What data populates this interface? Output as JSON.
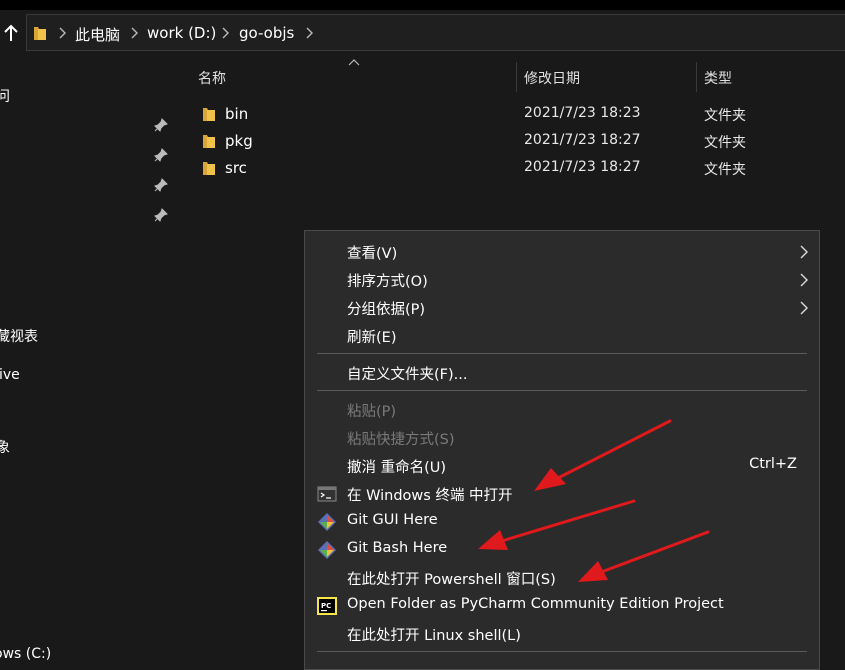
{
  "address_bar": {
    "breadcrumbs": [
      "此电脑",
      "work (D:)",
      "go-objs"
    ]
  },
  "sidebar": {
    "fragments": [
      "问",
      "藏视表",
      "ive",
      "象",
      "ows (C:)"
    ]
  },
  "columns": {
    "name": "名称",
    "date": "修改日期",
    "type": "类型"
  },
  "files": [
    {
      "name": "bin",
      "date": "2021/7/23 18:23",
      "type": "文件夹"
    },
    {
      "name": "pkg",
      "date": "2021/7/23 18:27",
      "type": "文件夹"
    },
    {
      "name": "src",
      "date": "2021/7/23 18:27",
      "type": "文件夹"
    }
  ],
  "context_menu": {
    "view": "查看(V)",
    "sort": "排序方式(O)",
    "group": "分组依据(P)",
    "refresh": "刷新(E)",
    "customize": "自定义文件夹(F)...",
    "paste": "粘贴(P)",
    "paste_shortcut": "粘贴快捷方式(S)",
    "undo": "撤消 重命名(U)",
    "undo_shortcut": "Ctrl+Z",
    "terminal": "在 Windows 终端 中打开",
    "git_gui": "Git GUI Here",
    "git_bash": "Git Bash Here",
    "powershell": "在此处打开 Powershell 窗口(S)",
    "pycharm": "Open Folder as PyCharm Community Edition Project",
    "linux_shell": "在此处打开 Linux shell(L)",
    "pycharm_icon_text": "PC"
  },
  "colors": {
    "background": "#191919",
    "menu_bg": "#2b2b2b",
    "folder": "#f0c24a",
    "annotation_arrow": "#e0191c"
  }
}
